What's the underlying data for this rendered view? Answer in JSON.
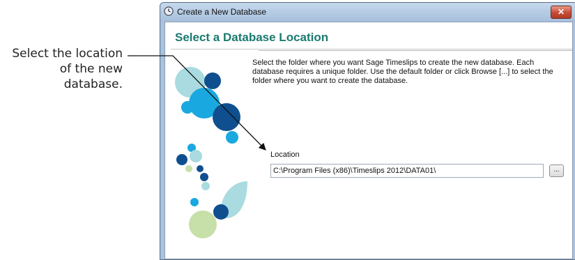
{
  "callout": {
    "line1": "Select the location",
    "line2": "of the new",
    "line3": "database."
  },
  "window": {
    "title": "Create a New Database",
    "close_label": "✕",
    "icon": "clock-app-icon"
  },
  "wizard": {
    "heading": "Select a Database Location",
    "description": "Select the folder where you want Sage Timeslips to create the new database. Each database requires a unique folder. Use the default folder or click Browse [...] to select the folder where you want to create the database.",
    "location_label": "Location",
    "location_value": "C:\\Program Files (x86)\\Timeslips 2012\\DATA01\\",
    "browse_label": "..."
  },
  "colors": {
    "heading": "#1a7a70",
    "accent_dark_blue": "#0f4f8f",
    "accent_cyan": "#19a8df",
    "accent_teal_light": "#a9dbe0",
    "accent_green_light": "#c7dfa8"
  }
}
